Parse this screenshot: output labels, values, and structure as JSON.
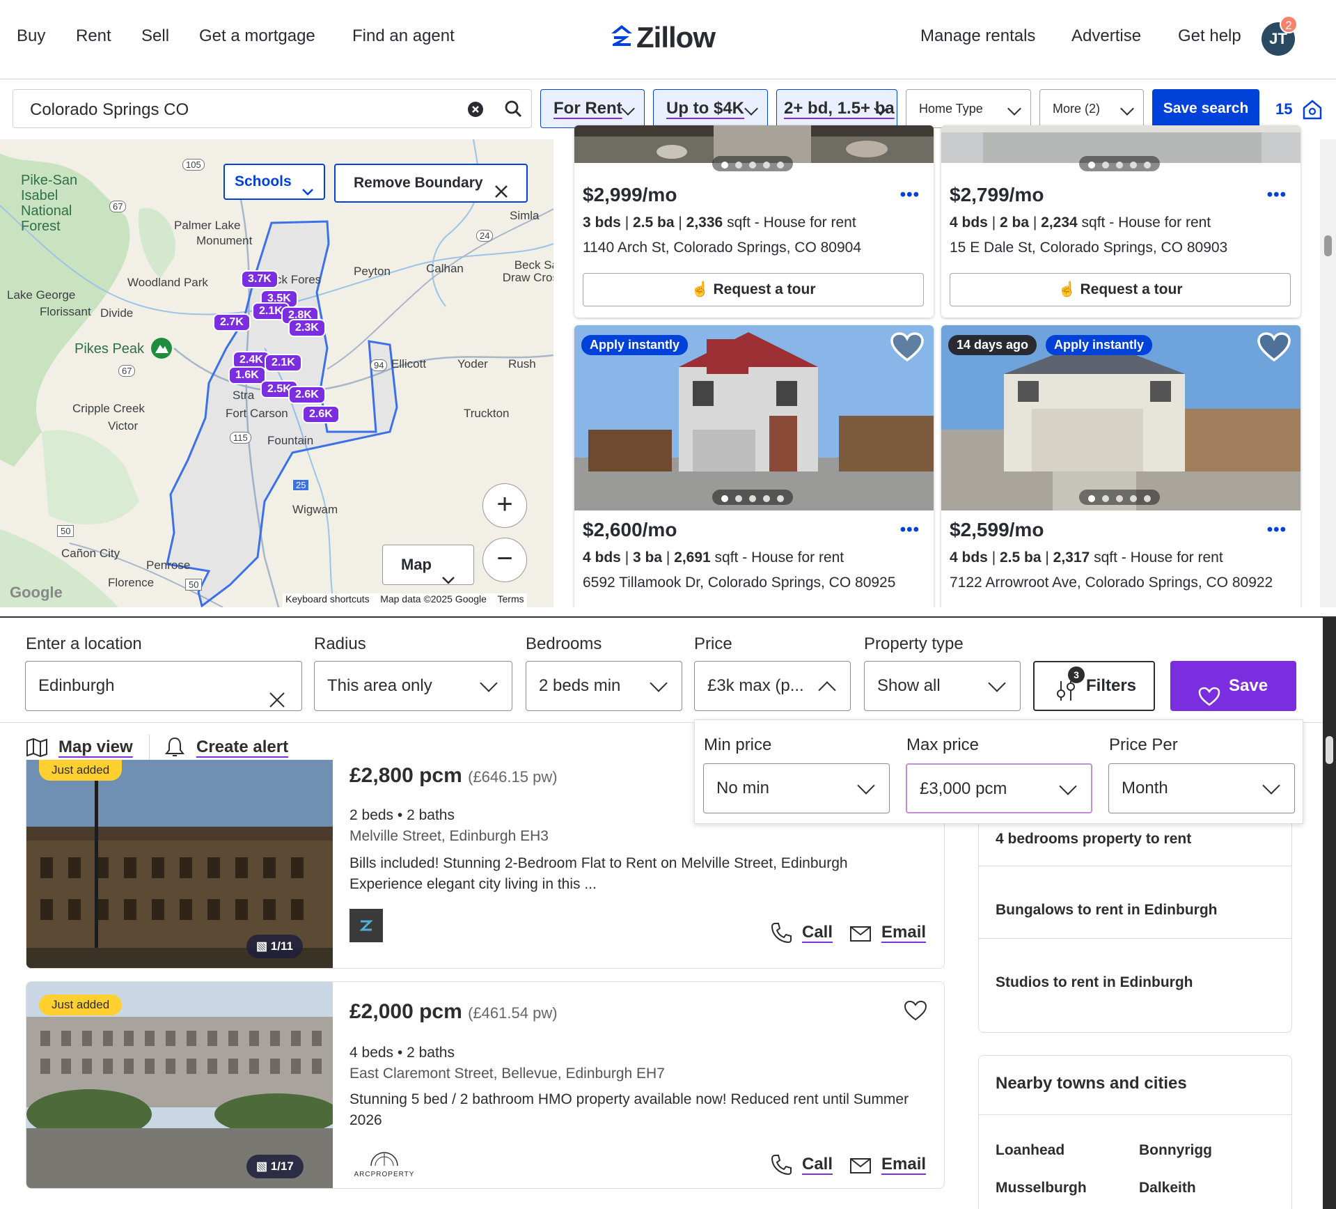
{
  "zillow": {
    "nav_left": [
      "Buy",
      "Rent",
      "Sell",
      "Get a mortgage",
      "Find an agent"
    ],
    "brand": "Zillow",
    "nav_right": [
      "Manage rentals",
      "Advertise",
      "Get help"
    ],
    "avatar_initials": "JT",
    "avatar_badge": "2",
    "search_value": "Colorado Springs CO",
    "filters": {
      "listing_type": "For Rent",
      "price": "Up to $4K",
      "beds_baths": "2+ bd, 1.5+ ba",
      "home_type": "Home Type",
      "more": "More (2)"
    },
    "save_search": "Save search",
    "saved_count": "15",
    "accent": "#0041d9",
    "map": {
      "schools_button": "Schools",
      "remove_boundary_button": "Remove Boundary",
      "map_type_button": "Map",
      "zoom_in": "+",
      "zoom_out": "−",
      "places": [
        "Pike-San Isabel National Forest",
        "Palmer Lake",
        "Monument",
        "Woodland Park",
        "Lake George",
        "Florissant",
        "Divide",
        "Pikes Peak",
        "Cripple Creek",
        "Victor",
        "Fort Carson",
        "Fountain",
        "Peyton",
        "Calhan",
        "Simla",
        "Beck Sa Draw Cros",
        "Ellicott",
        "Yoder",
        "Rush",
        "Truckton",
        "Wigwam",
        "Cañon City",
        "Penrose",
        "Florence",
        "Stra",
        "ck Fores"
      ],
      "road_shields": [
        "105",
        "67",
        "24",
        "94",
        "67",
        "115",
        "25",
        "50",
        "50"
      ],
      "pins": [
        "3.7K",
        "3.5K",
        "2.1K",
        "2.8K",
        "2.7K",
        "2.3K",
        "2.4K",
        "2.1K",
        "1.6K",
        "2.5K",
        "2.6K",
        "2.6K"
      ],
      "footer": [
        "Keyboard shortcuts",
        "Map data ©2025 Google",
        "Terms"
      ],
      "google_logo": "Google"
    },
    "listings": [
      {
        "price": "$2,999/mo",
        "beds": "3 bds",
        "baths": "2.5 ba",
        "sqft": "2,336",
        "sqft_unit": "sqft",
        "kind": "- House for rent",
        "address": "1140 Arch St, Colorado Springs, CO 80904",
        "tour": "Request a tour"
      },
      {
        "price": "$2,799/mo",
        "beds": "4 bds",
        "baths": "2 ba",
        "sqft": "2,234",
        "sqft_unit": "sqft",
        "kind": "- House for rent",
        "address": "15 E Dale St, Colorado Springs, CO 80903",
        "tour": "Request a tour"
      },
      {
        "price": "$2,600/mo",
        "beds": "4 bds",
        "baths": "3 ba",
        "sqft": "2,691",
        "sqft_unit": "sqft",
        "kind": "- House for rent",
        "address": "6592 Tillamook Dr, Colorado Springs, CO 80925",
        "tags": [
          "Apply instantly"
        ]
      },
      {
        "price": "$2,599/mo",
        "beds": "4 bds",
        "baths": "2.5 ba",
        "sqft": "2,317",
        "sqft_unit": "sqft",
        "kind": "- House for rent",
        "address": "7122 Arrowroot Ave, Colorado Springs, CO 80922",
        "tags": [
          "14 days ago",
          "Apply instantly"
        ]
      }
    ]
  },
  "edinburgh": {
    "accent": "#7b2de0",
    "labels": {
      "location": "Enter a location",
      "radius": "Radius",
      "bedrooms": "Bedrooms",
      "price": "Price",
      "property_type": "Property type"
    },
    "values": {
      "location": "Edinburgh",
      "radius": "This area only",
      "bedrooms": "2 beds min",
      "price": "£3k max (p...",
      "property_type": "Show all"
    },
    "filters_button": "Filters",
    "filters_count": "3",
    "save_button": "Save",
    "map_view": "Map view",
    "create_alert": "Create alert",
    "price_popover": {
      "min_label": "Min price",
      "min_value": "No min",
      "max_label": "Max price",
      "max_value": "£3,000 pcm",
      "per_label": "Price Per",
      "per_value": "Month"
    },
    "listings": [
      {
        "badge": "Just added",
        "price": "£2,800 pcm",
        "weekly": "(£646.15 pw)",
        "beds_baths": "2 beds • 2 baths",
        "address": "Melville Street, Edinburgh EH3",
        "description": "Bills included! Stunning 2-Bedroom Flat to Rent on Melville Street, Edinburgh Experience elegant city living in this ...",
        "images": "1/11",
        "call": "Call",
        "email": "Email"
      },
      {
        "badge": "Just added",
        "price": "£2,000 pcm",
        "weekly": "(£461.54 pw)",
        "beds_baths": "4 beds • 2 baths",
        "address": "East Claremont Street, Bellevue, Edinburgh EH7",
        "description": "Stunning 5 bed / 2 bathroom HMO property available now! Reduced rent until Summer 2026",
        "images": "1/17",
        "call": "Call",
        "email": "Email",
        "agent_logo_text": "ARCPROPERTY"
      }
    ],
    "side_links": [
      "4 bedrooms property to rent",
      "Bungalows to rent in Edinburgh",
      "Studios to rent in Edinburgh"
    ],
    "nearby_title": "Nearby towns and cities",
    "nearby": [
      "Loanhead",
      "Bonnyrigg",
      "Musselburgh",
      "Dalkeith"
    ]
  }
}
